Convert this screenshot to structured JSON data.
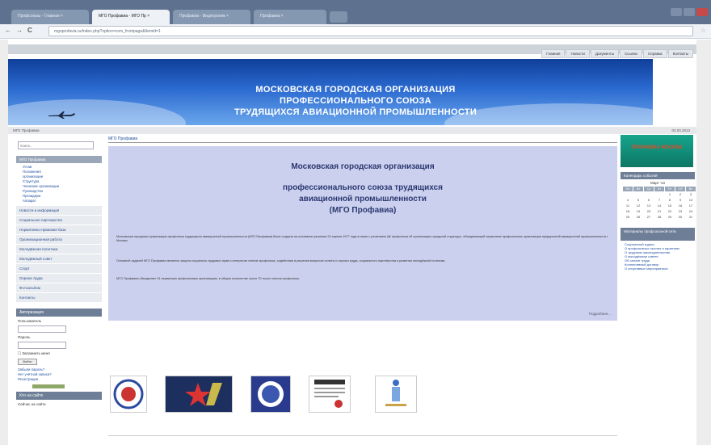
{
  "browser": {
    "tabs": [
      {
        "label": "Профсоюзы - Главная  ×"
      },
      {
        "label": "МГО Профавиа - МГО Пр  ×"
      },
      {
        "label": "Профавиа - Видеоролик  ×"
      },
      {
        "label": "Профавиа  ×"
      }
    ],
    "url": "mgoprofavia.ru/index.php?option=com_frontpage&Itemid=1",
    "back": "←",
    "forward": "→",
    "reload": "C",
    "star": "☆"
  },
  "site": {
    "top_menu": [
      "Главная",
      "Новости",
      "Документы",
      "Ссылки",
      "Справка",
      "Контакты"
    ],
    "banner_lines": [
      "МОСКОВСКАЯ ГОРОДСКАЯ ОРГАНИЗАЦИЯ",
      "ПРОФЕССИОНАЛЬНОГО СОЮЗА",
      "ТРУДЯЩИХСЯ АВИАЦИОННОЙ ПРОМЫШЛЕННОСТИ"
    ],
    "status_left": "МГО Профавиа",
    "status_date": "04.03.2013"
  },
  "left": {
    "search_placeholder": "поиск...",
    "menu_head": "МГО Профавиа",
    "submenu": [
      "Устав",
      "Положения",
      "организации",
      "Структура",
      "Членские организации",
      "Руководство",
      "Президиум",
      "Аппарат"
    ],
    "menu_items": [
      "Новости и информация",
      "Социальное партнерство",
      "Нормативно-правовая база",
      "Организационная работа",
      "Молодёжная политика",
      "Молодёжный совет",
      "Спорт",
      "Охрана труда",
      "Фотоальбом",
      "Контакты"
    ],
    "login_head": "Авторизация",
    "login_user_label": "Пользователь",
    "login_pass_label": "Пароль",
    "remember": "Запомнить меня",
    "login_btn": "Войти",
    "forgot": "Забыли пароль?",
    "no_account": "Нет учётной записи?",
    "register": "Регистрация",
    "bottom_head": "Кто на сайте",
    "bottom_text": "Сейчас на сайте"
  },
  "center": {
    "crumb": "МГО Профавиа",
    "title_1": "Московская городская организация",
    "title_2": "профессионального союза трудящихся",
    "title_3": "авиационной промышленности",
    "title_4": "(МГО Профавиа)",
    "para_1": "Московская городская организация профсоюза трудящихся авиационной промышленности (МГО Профавиа) была создана на основании решения 24 апреля 1977 года в связи с решением ЦК профсоюза об организации городской структуры, объединяющей первичные профсоюзные организации предприятий авиационной промышленности г. Москвы.",
    "para_2": "Основной задачей МГО Профавиа является защита социально-трудовых прав и интересов членов профсоюза, содействие в решении вопросов оплаты и охраны труда, социального партнёрства и развития молодёжной политики.",
    "para_3": "МГО Профавиа объединяет 31 первичную профсоюзную организацию, в общем количестве около 70 тысяч членов профсоюза.",
    "readmore": "Подробнее..."
  },
  "right": {
    "promo": "ПРОФАВИА МОСКВА",
    "calendar_head": "Календарь событий",
    "month": "Март '13",
    "weekdays": [
      "Пн",
      "Вт",
      "Ср",
      "Чт",
      "Пт",
      "Сб",
      "Вс"
    ],
    "days": [
      "",
      "",
      "",
      "",
      "1",
      "2",
      "3",
      "4",
      "5",
      "6",
      "7",
      "8",
      "9",
      "10",
      "11",
      "12",
      "13",
      "14",
      "15",
      "16",
      "17",
      "18",
      "19",
      "20",
      "21",
      "22",
      "23",
      "24",
      "25",
      "26",
      "27",
      "28",
      "29",
      "30",
      "31"
    ],
    "news_head": "Материалы профсоюзной сети",
    "news": [
      "Социальный кодекс",
      "О профсоюзных льготах и гарантиях",
      "О трудовом законодательстве",
      "О молодёжном совете",
      "Об оплате труда",
      "Коллективный договор",
      "О спортивных мероприятиях"
    ]
  }
}
